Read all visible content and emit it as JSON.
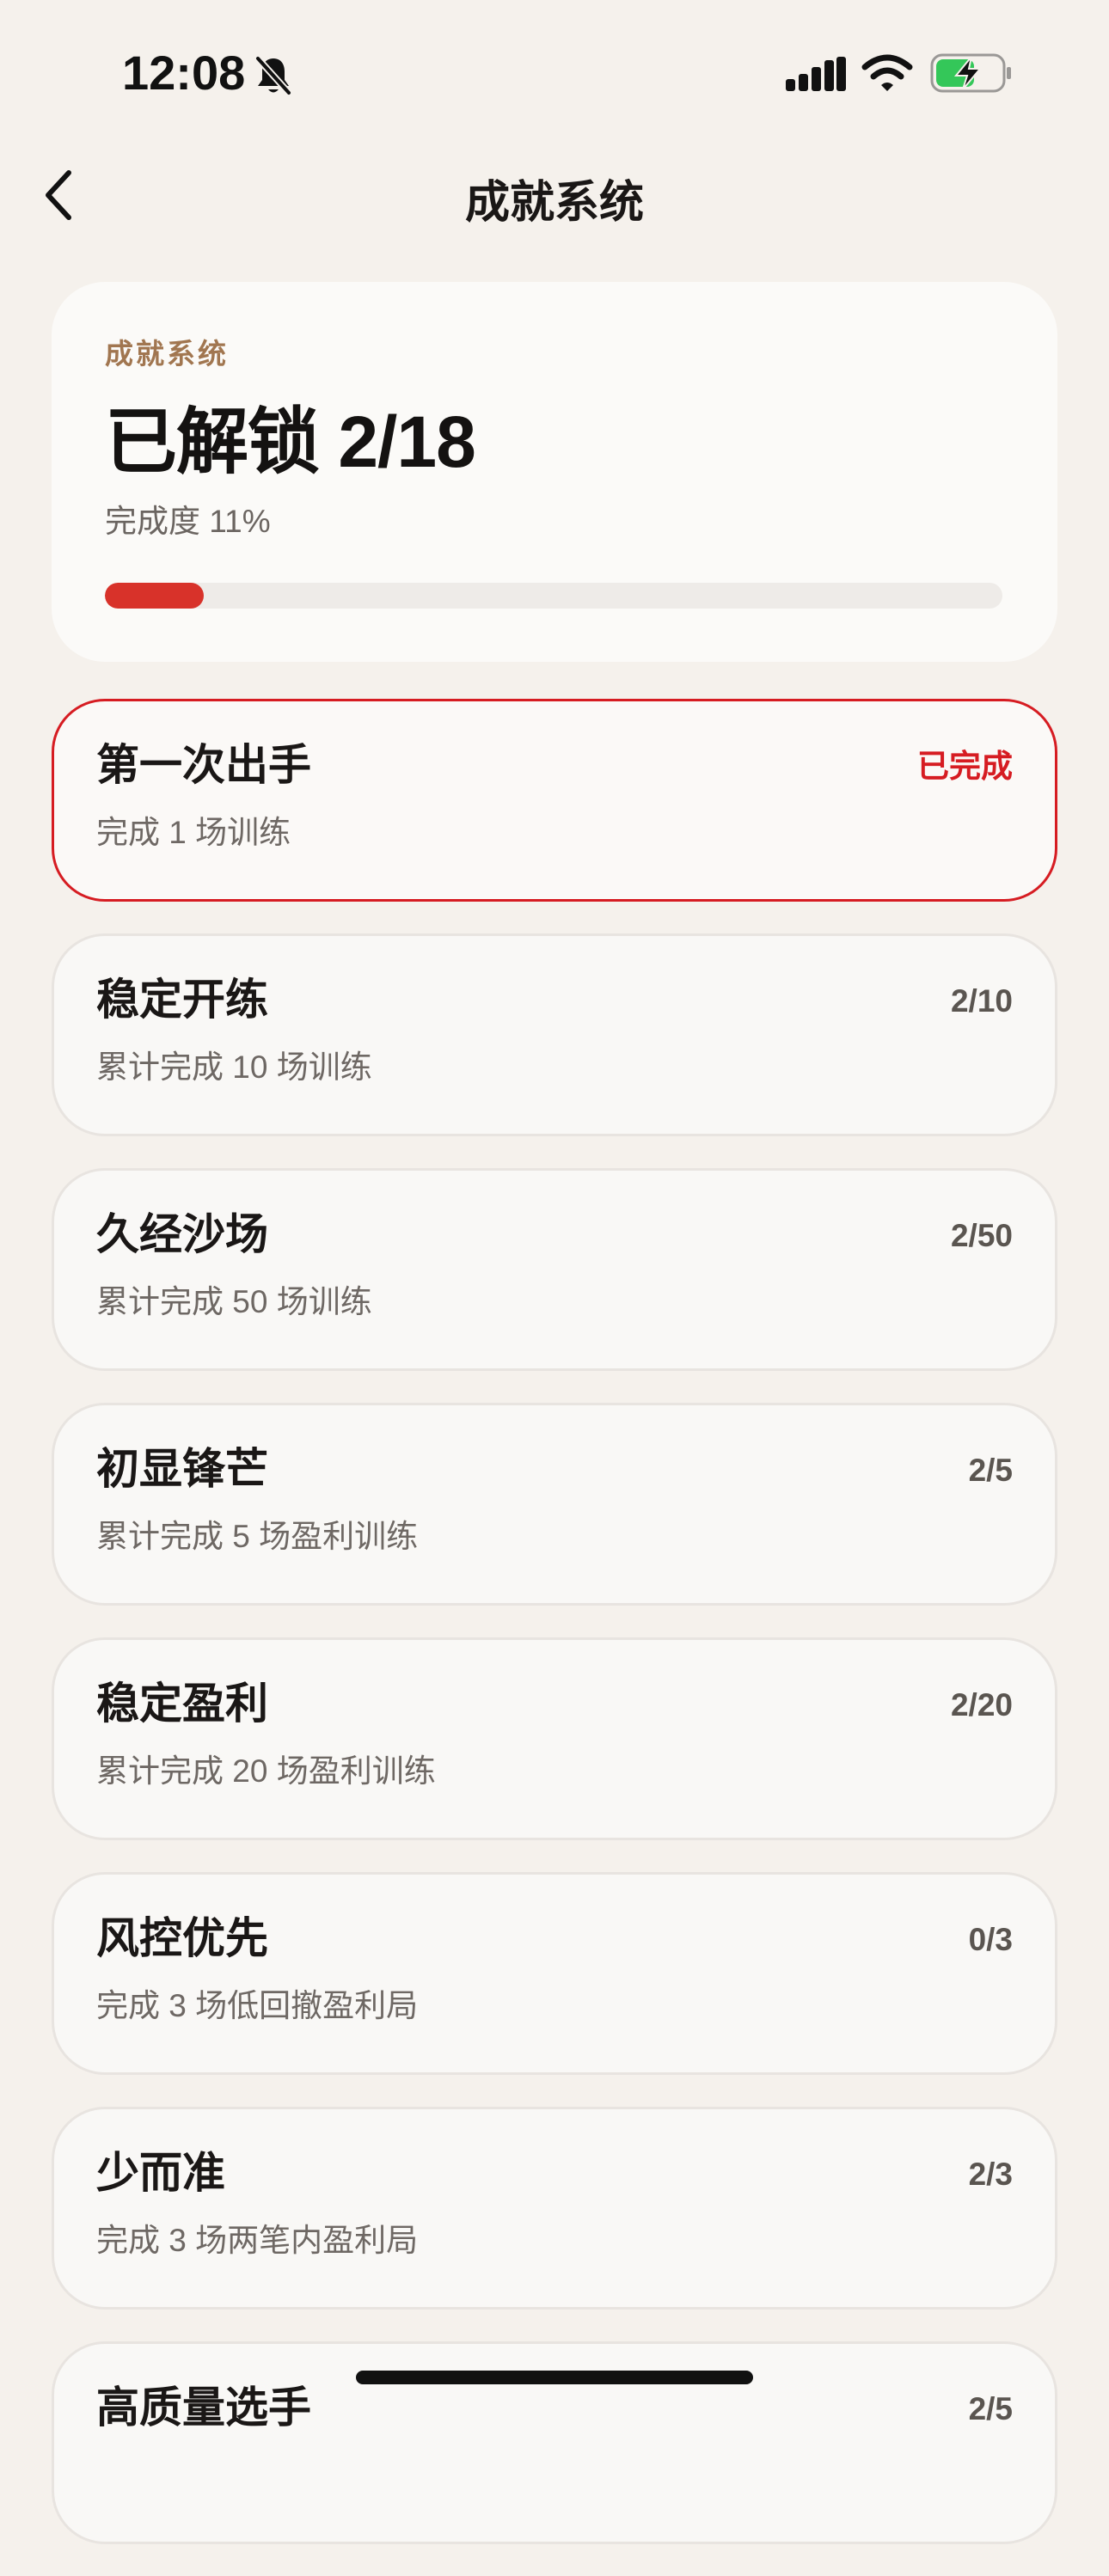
{
  "status_bar": {
    "time": "12:08",
    "icons": [
      "bell-slash-icon",
      "signal-icon",
      "wifi-icon",
      "battery-charging-icon"
    ],
    "battery_color": "#34c759"
  },
  "nav": {
    "back_icon": "chevron-left-icon",
    "title": "成就系统"
  },
  "summary": {
    "eyebrow": "成就系统",
    "headline": "已解锁 2/18",
    "percent_text": "完成度 11%",
    "progress_fraction": 0.11,
    "accent_color": "#d8322a"
  },
  "achievements": [
    {
      "title": "第一次出手",
      "desc": "完成 1 场训练",
      "status": "已完成",
      "done": true
    },
    {
      "title": "稳定开练",
      "desc": "累计完成 10 场训练",
      "status": "2/10",
      "done": false
    },
    {
      "title": "久经沙场",
      "desc": "累计完成 50 场训练",
      "status": "2/50",
      "done": false
    },
    {
      "title": "初显锋芒",
      "desc": "累计完成 5 场盈利训练",
      "status": "2/5",
      "done": false
    },
    {
      "title": "稳定盈利",
      "desc": "累计完成 20 场盈利训练",
      "status": "2/20",
      "done": false
    },
    {
      "title": "风控优先",
      "desc": "完成 3 场低回撤盈利局",
      "status": "0/3",
      "done": false
    },
    {
      "title": "少而准",
      "desc": "完成 3 场两笔内盈利局",
      "status": "2/3",
      "done": false
    },
    {
      "title": "高质量选手",
      "desc": "",
      "status": "2/5",
      "done": false
    }
  ]
}
